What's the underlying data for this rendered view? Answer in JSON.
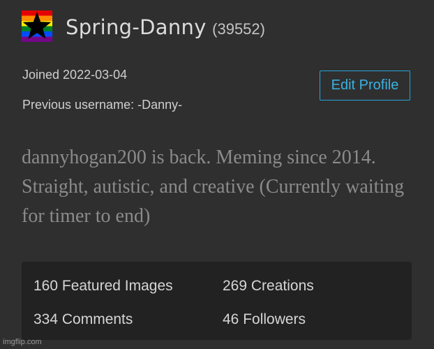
{
  "profile": {
    "icon": "rainbow-star-icon",
    "username": "Spring-Danny",
    "points": "(39552)",
    "joined": "Joined 2022-03-04",
    "previous_username": "Previous username: -Danny-",
    "edit_button_label": "Edit Profile",
    "bio": "dannyhogan200 is back. Meming since 2014. Straight, autistic, and creative (Currently waiting for timer to end)"
  },
  "stats": {
    "featured_images": "160 Featured Images",
    "creations": "269 Creations",
    "comments": "334 Comments",
    "followers": "46 Followers"
  },
  "colors": {
    "background": "#2f2f2f",
    "stats_background": "#222222",
    "accent": "#38b3e4",
    "bio_text": "#8b8b8b"
  },
  "watermark": "imgflip.com"
}
